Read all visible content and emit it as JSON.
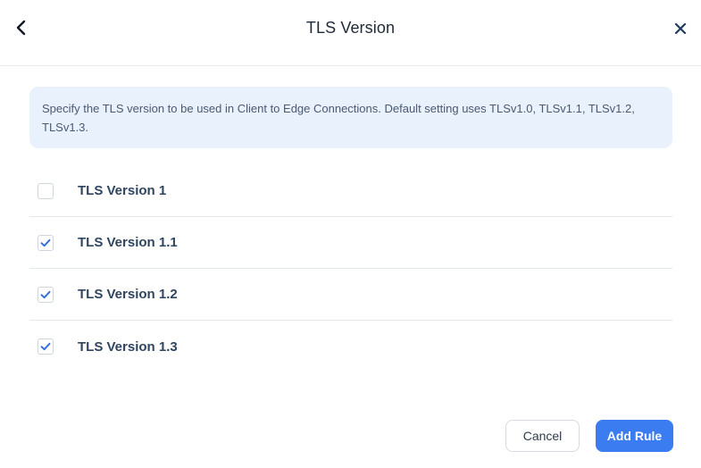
{
  "header": {
    "title": "TLS Version",
    "back_icon": "chevron-left-icon",
    "close_icon": "close-icon"
  },
  "info": {
    "text": "Specify the TLS version to be used in Client to Edge Connections. Default setting uses TLSv1.0, TLSv1.1, TLSv1.2, TLSv1.3."
  },
  "options": [
    {
      "label": "TLS Version 1",
      "checked": false
    },
    {
      "label": "TLS Version 1.1",
      "checked": true
    },
    {
      "label": "TLS Version 1.2",
      "checked": true
    },
    {
      "label": "TLS Version 1.3",
      "checked": true
    }
  ],
  "footer": {
    "cancel_label": "Cancel",
    "add_label": "Add Rule"
  },
  "colors": {
    "primary": "#3b7cf0",
    "check": "#2f6fe0",
    "info_bg": "#e8f1fc"
  }
}
